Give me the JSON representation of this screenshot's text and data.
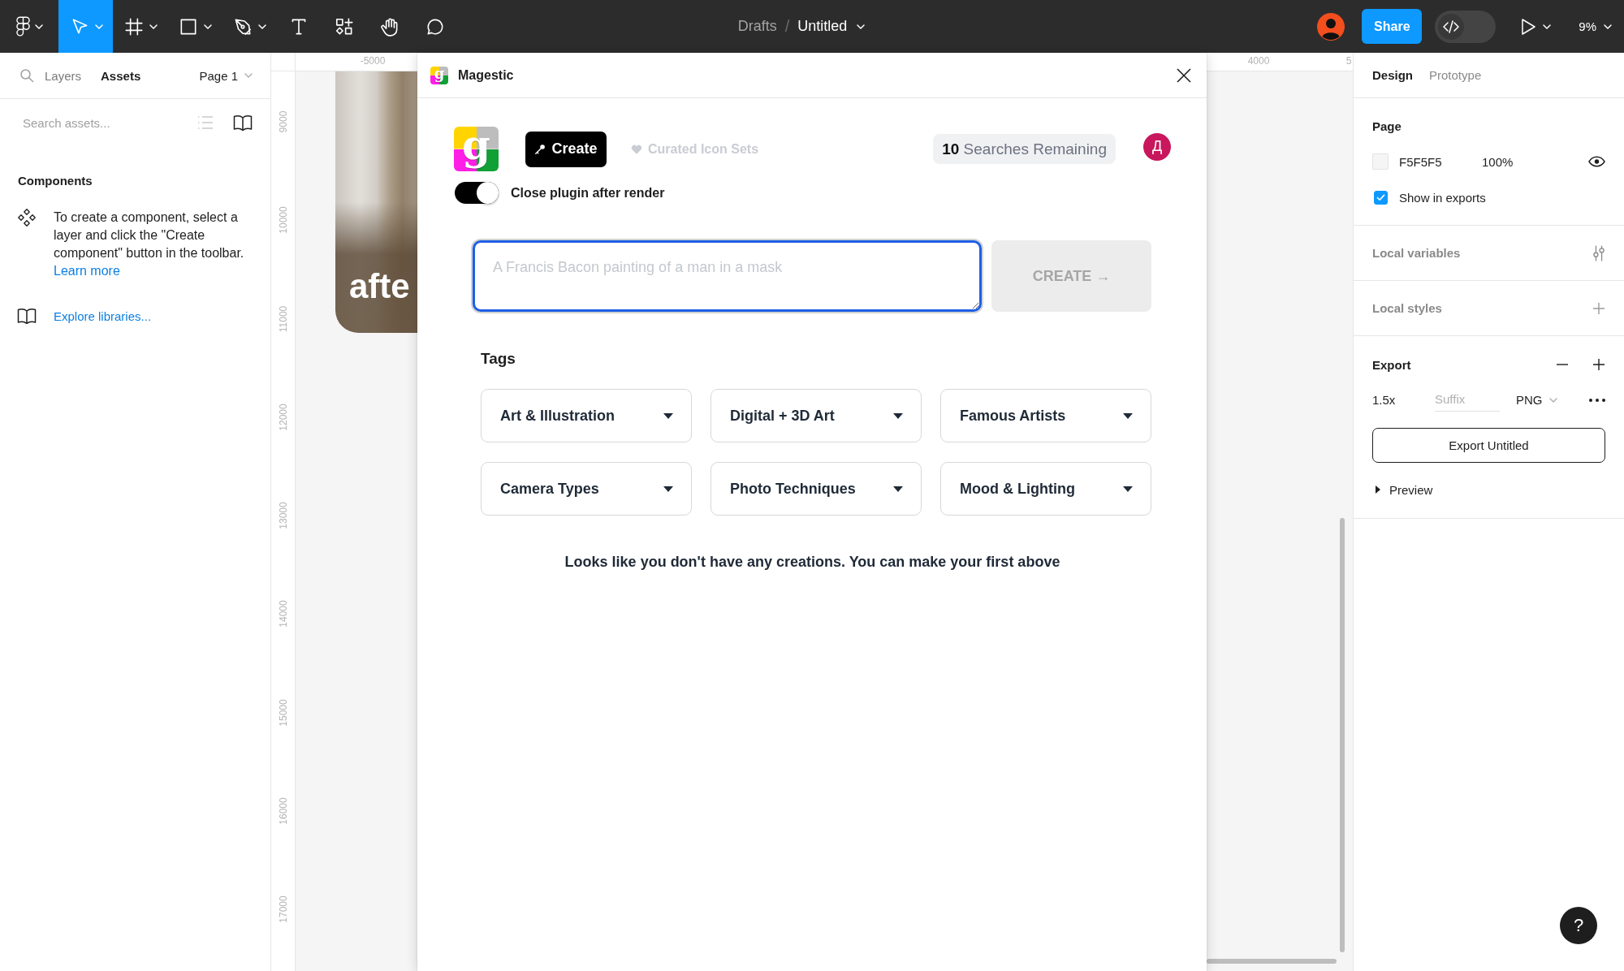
{
  "toolbar": {
    "tools": [
      {
        "kind": "logo",
        "selected": false,
        "has_menu": true
      },
      {
        "kind": "move",
        "selected": true,
        "has_menu": true
      },
      {
        "kind": "frame",
        "selected": false,
        "has_menu": true
      },
      {
        "kind": "rectangle",
        "selected": false,
        "has_menu": true
      },
      {
        "kind": "pen",
        "selected": false,
        "has_menu": true
      },
      {
        "kind": "text",
        "selected": false,
        "has_menu": false
      },
      {
        "kind": "resources",
        "selected": false,
        "has_menu": false
      },
      {
        "kind": "hand",
        "selected": false,
        "has_menu": false
      },
      {
        "kind": "comment",
        "selected": false,
        "has_menu": false
      }
    ],
    "breadcrumb": {
      "folder": "Drafts",
      "separator": "/",
      "file": "Untitled"
    },
    "share": "Share",
    "dev_mode_on": false,
    "zoom": "9%"
  },
  "left_panel": {
    "tabs": [
      {
        "label": "Layers",
        "selected": false
      },
      {
        "label": "Assets",
        "selected": true
      }
    ],
    "page": "Page 1",
    "search": {
      "placeholder": "Search assets..."
    },
    "components": {
      "title": "Components",
      "hint": "To create a component, select a layer and click the \"Create component\" button in the toolbar.",
      "link": "Learn more"
    },
    "explore": "Explore libraries..."
  },
  "canvas": {
    "top_ruler": [
      "-5000",
      "4000",
      "5"
    ],
    "left_ruler": [
      "9000",
      "10000",
      "11000",
      "12000",
      "13000",
      "14000",
      "15000",
      "16000",
      "17000"
    ],
    "frame_text": "afte"
  },
  "plugin": {
    "title": "Magestic",
    "icon_letter": "g",
    "logo_letter": "g",
    "nav": [
      {
        "label": "Create",
        "selected": true
      },
      {
        "label": "Curated Icon Sets",
        "selected": false
      }
    ],
    "searches_remaining": "**10** Searches Remaining",
    "avatar_letter": "Д",
    "close_after_render": {
      "label": "Close plugin after render",
      "on": true
    },
    "prompt": {
      "placeholder": "A Francis Bacon painting of a man in a mask"
    },
    "create_button": {
      "label": "CREATE →",
      "disabled": true
    },
    "tags_title": "Tags",
    "tags": [
      {
        "label": "Art & Illustration"
      },
      {
        "label": "Digital + 3D Art"
      },
      {
        "label": "Famous Artists"
      },
      {
        "label": "Camera Types"
      },
      {
        "label": "Photo Techniques"
      },
      {
        "label": "Mood & Lighting"
      }
    ],
    "empty_message": "Looks like you don't have any creations. You can make your first above"
  },
  "right_panel": {
    "tabs": [
      {
        "label": "Design",
        "selected": true
      },
      {
        "label": "Prototype",
        "selected": false
      }
    ],
    "page": {
      "title": "Page",
      "hex_value": "F5F5F5",
      "opacity": "100%",
      "visible": true,
      "show_in_exports": {
        "label": "Show in exports",
        "checked": true
      }
    },
    "local_variables": "Local variables",
    "local_styles": "Local styles",
    "export": {
      "title": "Export",
      "scale": "1.5x",
      "suffix_placeholder": "Suffix",
      "format": "PNG",
      "button": "Export Untitled",
      "preview": {
        "label": "Preview",
        "expanded": false
      }
    }
  },
  "help": "?"
}
